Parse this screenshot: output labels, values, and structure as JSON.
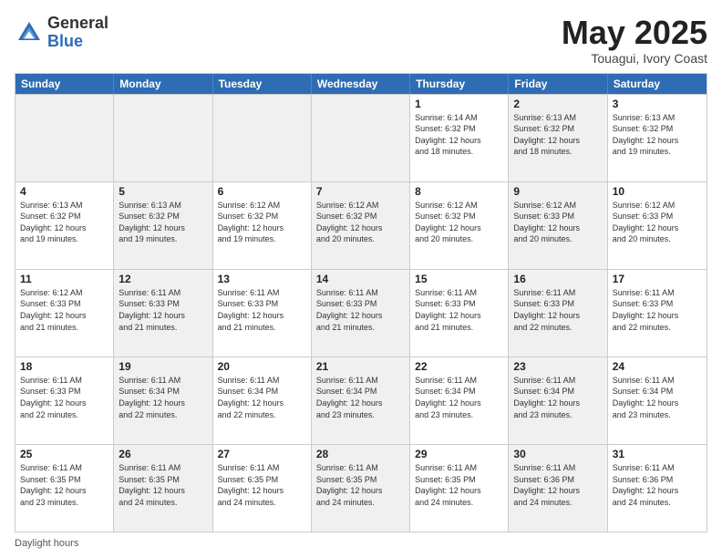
{
  "header": {
    "logo_general": "General",
    "logo_blue": "Blue",
    "month_title": "May 2025",
    "location": "Touagui, Ivory Coast"
  },
  "days_of_week": [
    "Sunday",
    "Monday",
    "Tuesday",
    "Wednesday",
    "Thursday",
    "Friday",
    "Saturday"
  ],
  "footer_text": "Daylight hours",
  "weeks": [
    [
      {
        "day": "",
        "info": "",
        "shaded": true
      },
      {
        "day": "",
        "info": "",
        "shaded": true
      },
      {
        "day": "",
        "info": "",
        "shaded": true
      },
      {
        "day": "",
        "info": "",
        "shaded": true
      },
      {
        "day": "1",
        "info": "Sunrise: 6:14 AM\nSunset: 6:32 PM\nDaylight: 12 hours\nand 18 minutes.",
        "shaded": false
      },
      {
        "day": "2",
        "info": "Sunrise: 6:13 AM\nSunset: 6:32 PM\nDaylight: 12 hours\nand 18 minutes.",
        "shaded": true
      },
      {
        "day": "3",
        "info": "Sunrise: 6:13 AM\nSunset: 6:32 PM\nDaylight: 12 hours\nand 19 minutes.",
        "shaded": false
      }
    ],
    [
      {
        "day": "4",
        "info": "Sunrise: 6:13 AM\nSunset: 6:32 PM\nDaylight: 12 hours\nand 19 minutes.",
        "shaded": false
      },
      {
        "day": "5",
        "info": "Sunrise: 6:13 AM\nSunset: 6:32 PM\nDaylight: 12 hours\nand 19 minutes.",
        "shaded": true
      },
      {
        "day": "6",
        "info": "Sunrise: 6:12 AM\nSunset: 6:32 PM\nDaylight: 12 hours\nand 19 minutes.",
        "shaded": false
      },
      {
        "day": "7",
        "info": "Sunrise: 6:12 AM\nSunset: 6:32 PM\nDaylight: 12 hours\nand 20 minutes.",
        "shaded": true
      },
      {
        "day": "8",
        "info": "Sunrise: 6:12 AM\nSunset: 6:32 PM\nDaylight: 12 hours\nand 20 minutes.",
        "shaded": false
      },
      {
        "day": "9",
        "info": "Sunrise: 6:12 AM\nSunset: 6:33 PM\nDaylight: 12 hours\nand 20 minutes.",
        "shaded": true
      },
      {
        "day": "10",
        "info": "Sunrise: 6:12 AM\nSunset: 6:33 PM\nDaylight: 12 hours\nand 20 minutes.",
        "shaded": false
      }
    ],
    [
      {
        "day": "11",
        "info": "Sunrise: 6:12 AM\nSunset: 6:33 PM\nDaylight: 12 hours\nand 21 minutes.",
        "shaded": false
      },
      {
        "day": "12",
        "info": "Sunrise: 6:11 AM\nSunset: 6:33 PM\nDaylight: 12 hours\nand 21 minutes.",
        "shaded": true
      },
      {
        "day": "13",
        "info": "Sunrise: 6:11 AM\nSunset: 6:33 PM\nDaylight: 12 hours\nand 21 minutes.",
        "shaded": false
      },
      {
        "day": "14",
        "info": "Sunrise: 6:11 AM\nSunset: 6:33 PM\nDaylight: 12 hours\nand 21 minutes.",
        "shaded": true
      },
      {
        "day": "15",
        "info": "Sunrise: 6:11 AM\nSunset: 6:33 PM\nDaylight: 12 hours\nand 21 minutes.",
        "shaded": false
      },
      {
        "day": "16",
        "info": "Sunrise: 6:11 AM\nSunset: 6:33 PM\nDaylight: 12 hours\nand 22 minutes.",
        "shaded": true
      },
      {
        "day": "17",
        "info": "Sunrise: 6:11 AM\nSunset: 6:33 PM\nDaylight: 12 hours\nand 22 minutes.",
        "shaded": false
      }
    ],
    [
      {
        "day": "18",
        "info": "Sunrise: 6:11 AM\nSunset: 6:33 PM\nDaylight: 12 hours\nand 22 minutes.",
        "shaded": false
      },
      {
        "day": "19",
        "info": "Sunrise: 6:11 AM\nSunset: 6:34 PM\nDaylight: 12 hours\nand 22 minutes.",
        "shaded": true
      },
      {
        "day": "20",
        "info": "Sunrise: 6:11 AM\nSunset: 6:34 PM\nDaylight: 12 hours\nand 22 minutes.",
        "shaded": false
      },
      {
        "day": "21",
        "info": "Sunrise: 6:11 AM\nSunset: 6:34 PM\nDaylight: 12 hours\nand 23 minutes.",
        "shaded": true
      },
      {
        "day": "22",
        "info": "Sunrise: 6:11 AM\nSunset: 6:34 PM\nDaylight: 12 hours\nand 23 minutes.",
        "shaded": false
      },
      {
        "day": "23",
        "info": "Sunrise: 6:11 AM\nSunset: 6:34 PM\nDaylight: 12 hours\nand 23 minutes.",
        "shaded": true
      },
      {
        "day": "24",
        "info": "Sunrise: 6:11 AM\nSunset: 6:34 PM\nDaylight: 12 hours\nand 23 minutes.",
        "shaded": false
      }
    ],
    [
      {
        "day": "25",
        "info": "Sunrise: 6:11 AM\nSunset: 6:35 PM\nDaylight: 12 hours\nand 23 minutes.",
        "shaded": false
      },
      {
        "day": "26",
        "info": "Sunrise: 6:11 AM\nSunset: 6:35 PM\nDaylight: 12 hours\nand 24 minutes.",
        "shaded": true
      },
      {
        "day": "27",
        "info": "Sunrise: 6:11 AM\nSunset: 6:35 PM\nDaylight: 12 hours\nand 24 minutes.",
        "shaded": false
      },
      {
        "day": "28",
        "info": "Sunrise: 6:11 AM\nSunset: 6:35 PM\nDaylight: 12 hours\nand 24 minutes.",
        "shaded": true
      },
      {
        "day": "29",
        "info": "Sunrise: 6:11 AM\nSunset: 6:35 PM\nDaylight: 12 hours\nand 24 minutes.",
        "shaded": false
      },
      {
        "day": "30",
        "info": "Sunrise: 6:11 AM\nSunset: 6:36 PM\nDaylight: 12 hours\nand 24 minutes.",
        "shaded": true
      },
      {
        "day": "31",
        "info": "Sunrise: 6:11 AM\nSunset: 6:36 PM\nDaylight: 12 hours\nand 24 minutes.",
        "shaded": false
      }
    ]
  ]
}
